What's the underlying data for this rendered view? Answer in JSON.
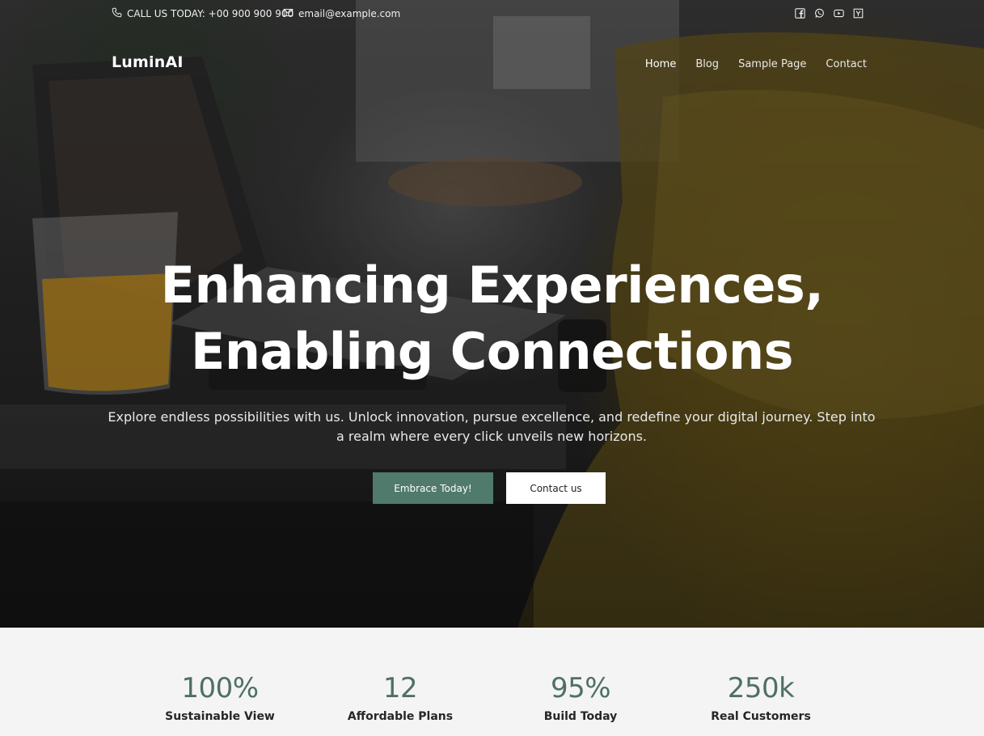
{
  "topbar": {
    "phone_text": "CALL US TODAY: +00 900 900 900",
    "email_text": "email@example.com",
    "socials": [
      "facebook-icon",
      "whatsapp-icon",
      "youtube-icon",
      "y-combinator-icon"
    ]
  },
  "header": {
    "logo": "LuminAI",
    "nav": [
      "Home",
      "Blog",
      "Sample Page",
      "Contact"
    ]
  },
  "hero": {
    "title_line1": "Enhancing Experiences,",
    "title_line2": "Enabling Connections",
    "subtitle": "Explore endless possibilities with us. Unlock innovation, pursue excellence, and redefine your digital journey. Step into a realm where every click unveils new horizons.",
    "primary_button": "Embrace Today!",
    "secondary_button": "Contact us"
  },
  "stats": [
    {
      "value": "100%",
      "label": "Sustainable View"
    },
    {
      "value": "12",
      "label": "Affordable Plans"
    },
    {
      "value": "95%",
      "label": "Build Today"
    },
    {
      "value": "250k",
      "label": "Real Customers"
    }
  ],
  "colors": {
    "accent": "#4f7a6c",
    "stat_number": "#4f6f66",
    "stats_bg": "#f4f4f4"
  }
}
